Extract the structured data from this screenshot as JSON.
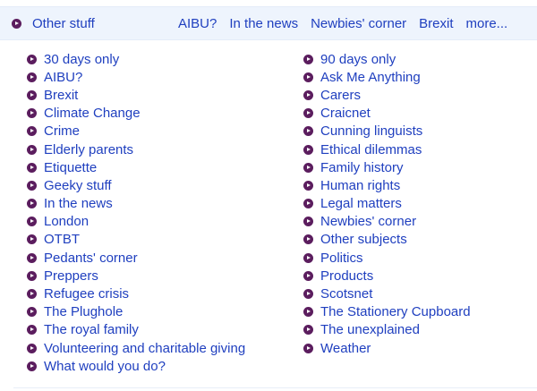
{
  "topbar": {
    "other_label": "Other stuff",
    "nav": [
      "AIBU?",
      "In the news",
      "Newbies' corner",
      "Brexit",
      "more..."
    ]
  },
  "left_column": [
    "30 days only",
    "AIBU?",
    "Brexit",
    "Climate Change",
    "Crime",
    "Elderly parents",
    "Etiquette",
    "Geeky stuff",
    "In the news",
    "London",
    "OTBT",
    "Pedants' corner",
    "Preppers",
    "Refugee crisis",
    "The Plughole",
    "The royal family",
    "Volunteering and charitable giving",
    "What would you do?"
  ],
  "right_column": [
    "90 days only",
    "Ask Me Anything",
    "Carers",
    "Craicnet",
    "Cunning linguists",
    "Ethical dilemmas",
    "Family history",
    "Human rights",
    "Legal matters",
    "Newbies' corner",
    "Other subjects",
    "Politics",
    "Products",
    "Scotsnet",
    "The Stationery Cupboard",
    "The unexplained",
    "Weather"
  ],
  "colors": {
    "link": "#1f3fbf",
    "bullet": "#5b1d5e",
    "topbar_bg": "#eef4fd"
  },
  "icons": {
    "bullet": "arrow-circle-icon"
  }
}
